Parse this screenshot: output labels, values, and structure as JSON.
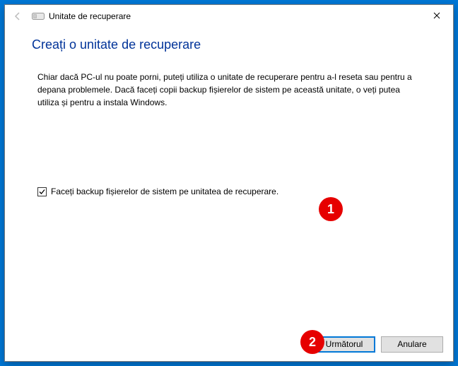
{
  "window": {
    "title": "Unitate de recuperare"
  },
  "heading": "Creați o unitate de recuperare",
  "description": "Chiar dacă PC-ul nu poate porni, puteți utiliza o unitate de recuperare pentru a-l reseta sau pentru a depana problemele. Dacă faceți copii backup fișierelor de sistem pe această unitate, o veți putea utiliza și pentru a instala Windows.",
  "checkbox": {
    "checked": true,
    "label": "Faceți backup fișierelor de sistem pe unitatea de recuperare."
  },
  "buttons": {
    "next": "Următorul",
    "cancel": "Anulare"
  },
  "annotations": {
    "badge1": "1",
    "badge2": "2"
  }
}
